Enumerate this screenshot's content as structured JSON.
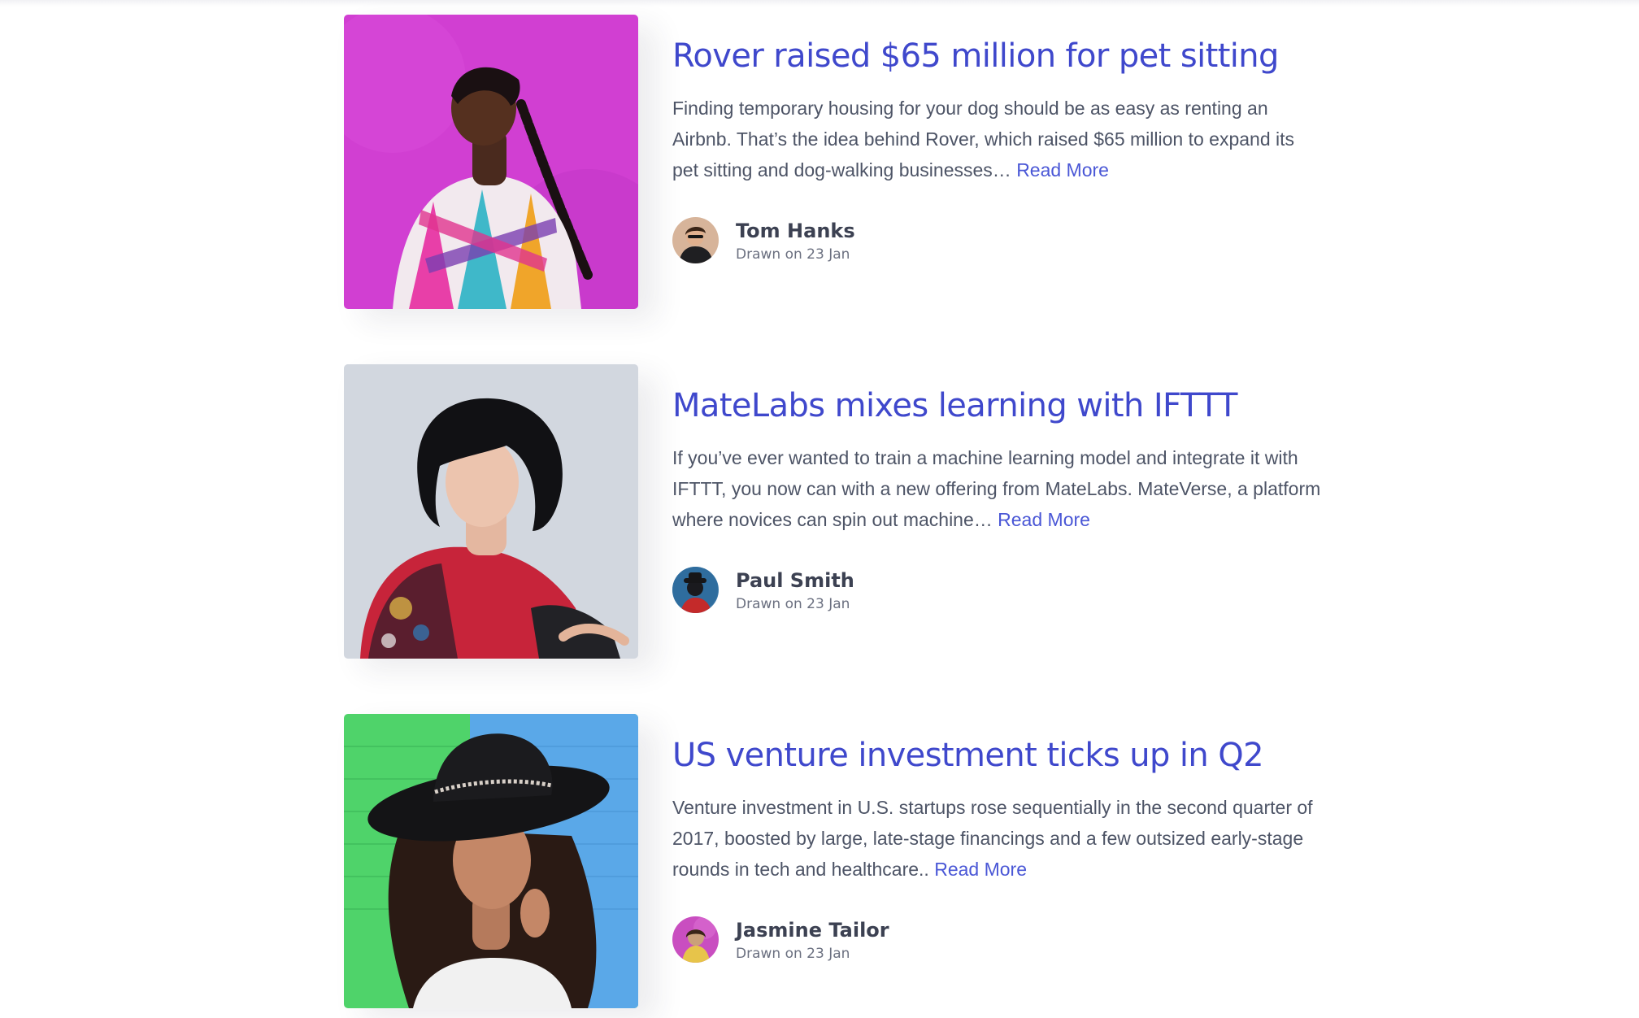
{
  "posts": [
    {
      "title": "Rover raised $65 million for pet sitting",
      "excerpt": "Finding temporary housing for your dog should be as easy as renting an Airbnb. That’s the idea behind Rover, which raised $65 million to expand its pet sitting and dog-walking businesses… ",
      "read_more": "Read More",
      "author": "Tom Hanks",
      "meta": "Drawn on 23 Jan"
    },
    {
      "title": "MateLabs mixes learning with IFTTT",
      "excerpt": "If you’ve ever wanted to train a machine learning model and integrate it with IFTTT, you now can with a new offering from MateLabs. MateVerse, a platform where novices can spin out machine… ",
      "read_more": "Read More",
      "author": "Paul Smith",
      "meta": "Drawn on 23 Jan"
    },
    {
      "title": "US venture investment ticks up in Q2",
      "excerpt": "Venture investment in U.S. startups rose sequentially in the second quarter of 2017, boosted by large, late-stage financings and a few outsized early-stage rounds in tech and healthcare.. ",
      "read_more": "Read More",
      "author": "Jasmine Tailor",
      "meta": "Drawn on 23 Jan"
    }
  ],
  "colors": {
    "title": "#3f48cc",
    "link": "#4a57d6",
    "body_text": "#4d5466",
    "author_name": "#3c4152",
    "meta_text": "#6b7080"
  }
}
